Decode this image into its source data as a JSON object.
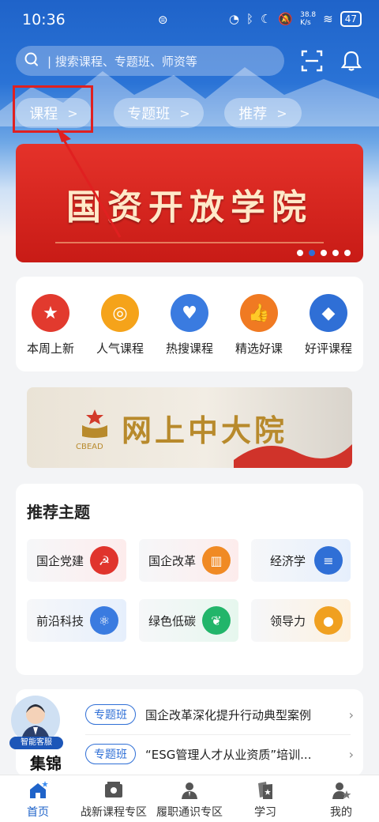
{
  "status_bar": {
    "time": "10:36",
    "net_speed": "38.8\nK/s",
    "battery": "47"
  },
  "search": {
    "placeholder": "| 搜索课程、专题班、师资等"
  },
  "icons": {
    "search": "search-icon",
    "scan": "scan-icon",
    "bell": "bell-icon"
  },
  "nav_pills": [
    {
      "label": "课程",
      "chevron": ">"
    },
    {
      "label": "专题班",
      "chevron": ">"
    },
    {
      "label": "推荐",
      "chevron": ">"
    }
  ],
  "banner": {
    "title": "国资开放学院",
    "pages": 5,
    "active_page": 2
  },
  "categories": [
    {
      "label": "本周上新",
      "icon": "star-icon",
      "color": "#e23a2e"
    },
    {
      "label": "人气课程",
      "icon": "popular-icon",
      "color": "#f5a31a"
    },
    {
      "label": "热搜课程",
      "icon": "heart-icon",
      "color": "#3a7be0"
    },
    {
      "label": "精选好课",
      "icon": "thumbs-up-icon",
      "color": "#f07a22"
    },
    {
      "label": "好评课程",
      "icon": "diamond-icon",
      "color": "#2f6fd6"
    }
  ],
  "cbead": {
    "title": "网上中大院",
    "sub": "CBEAD"
  },
  "topics": {
    "title": "推荐主题",
    "items": [
      {
        "label": "国企党建",
        "icon": "party-emblem-icon",
        "color": "#e0342c"
      },
      {
        "label": "国企改革",
        "icon": "building-icon",
        "color": "#f08a24"
      },
      {
        "label": "经济学",
        "icon": "coins-icon",
        "color": "#2f6fd6"
      },
      {
        "label": "前沿科技",
        "icon": "atom-icon",
        "color": "#3a7be0"
      },
      {
        "label": "绿色低碳",
        "icon": "leaf-icon",
        "color": "#22b56a"
      },
      {
        "label": "领导力",
        "icon": "person-icon",
        "color": "#f0a020"
      }
    ]
  },
  "featured": {
    "customer_service": "智能客服",
    "label": "集锦",
    "items": [
      {
        "tag": "专题班",
        "text": "国企改革深化提升行动典型案例"
      },
      {
        "tag": "专题班",
        "text": "“ESG管理人才从业资质”培训..."
      }
    ]
  },
  "tabbar": [
    {
      "label": "首页",
      "icon": "home-icon",
      "active": true
    },
    {
      "label": "战新课程专区",
      "icon": "emerging-courses-icon",
      "active": false
    },
    {
      "label": "履职通识专区",
      "icon": "general-knowledge-icon",
      "active": false
    },
    {
      "label": "学习",
      "icon": "study-icon",
      "active": false
    },
    {
      "label": "我的",
      "icon": "profile-icon",
      "active": false
    }
  ]
}
